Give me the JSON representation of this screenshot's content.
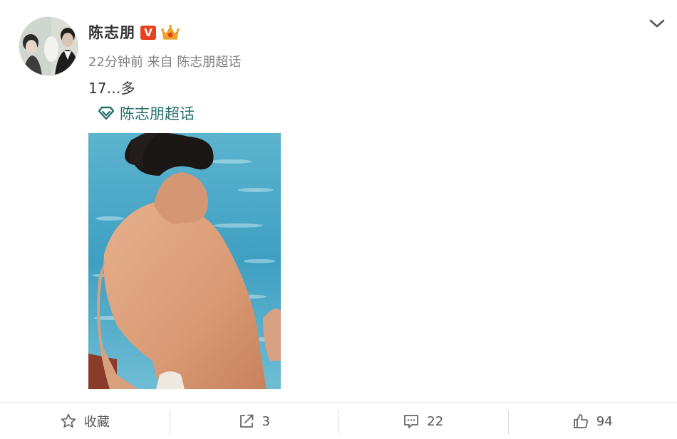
{
  "author": {
    "name": "陈志朋",
    "verified_badge_letter": "V",
    "verified_color": "#e8401f",
    "member_badge_icon": "crown-member-icon"
  },
  "meta": {
    "time": "22分钟前",
    "from_label": "来自",
    "source": "陈志朋超话"
  },
  "post": {
    "text": "17…多"
  },
  "topic": {
    "label": "陈志朋超话",
    "icon": "diamond-icon",
    "color": "#26706b"
  },
  "actions": {
    "favorite": {
      "label": "收藏",
      "icon": "star-icon"
    },
    "repost": {
      "count": "3",
      "icon": "share-icon"
    },
    "comment": {
      "count": "22",
      "icon": "comment-icon"
    },
    "like": {
      "count": "94",
      "icon": "thumbs-up-icon"
    }
  },
  "menu": {
    "icon": "chevron-down-icon"
  }
}
